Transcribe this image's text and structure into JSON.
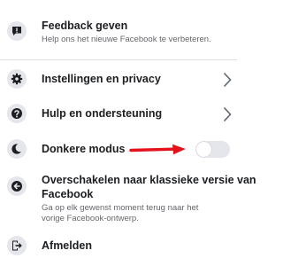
{
  "menu": {
    "feedback": {
      "title": "Feedback geven",
      "subtitle": "Help ons het nieuwe Facebook te verbeteren.",
      "icon": "feedback-icon"
    },
    "settings": {
      "title": "Instellingen en privacy",
      "icon": "gear-icon"
    },
    "help": {
      "title": "Hulp en ondersteuning",
      "icon": "question-icon"
    },
    "darkmode": {
      "title": "Donkere modus",
      "icon": "moon-icon",
      "enabled": false
    },
    "classic": {
      "title_line1": "Overschakelen naar klassieke versie van",
      "title_line2": "Facebook",
      "subtitle_line1": "Ga op elk gewenst moment terug naar het",
      "subtitle_line2": "vorige Facebook-ontwerp.",
      "icon": "back-arrow-icon"
    },
    "logout": {
      "title": "Afmelden",
      "icon": "logout-icon"
    }
  },
  "colors": {
    "annotation_arrow": "#e4131b",
    "icon_background": "#e4e6eb",
    "icon_glyph": "#1c1e21",
    "subtitle_text": "#65676b"
  }
}
